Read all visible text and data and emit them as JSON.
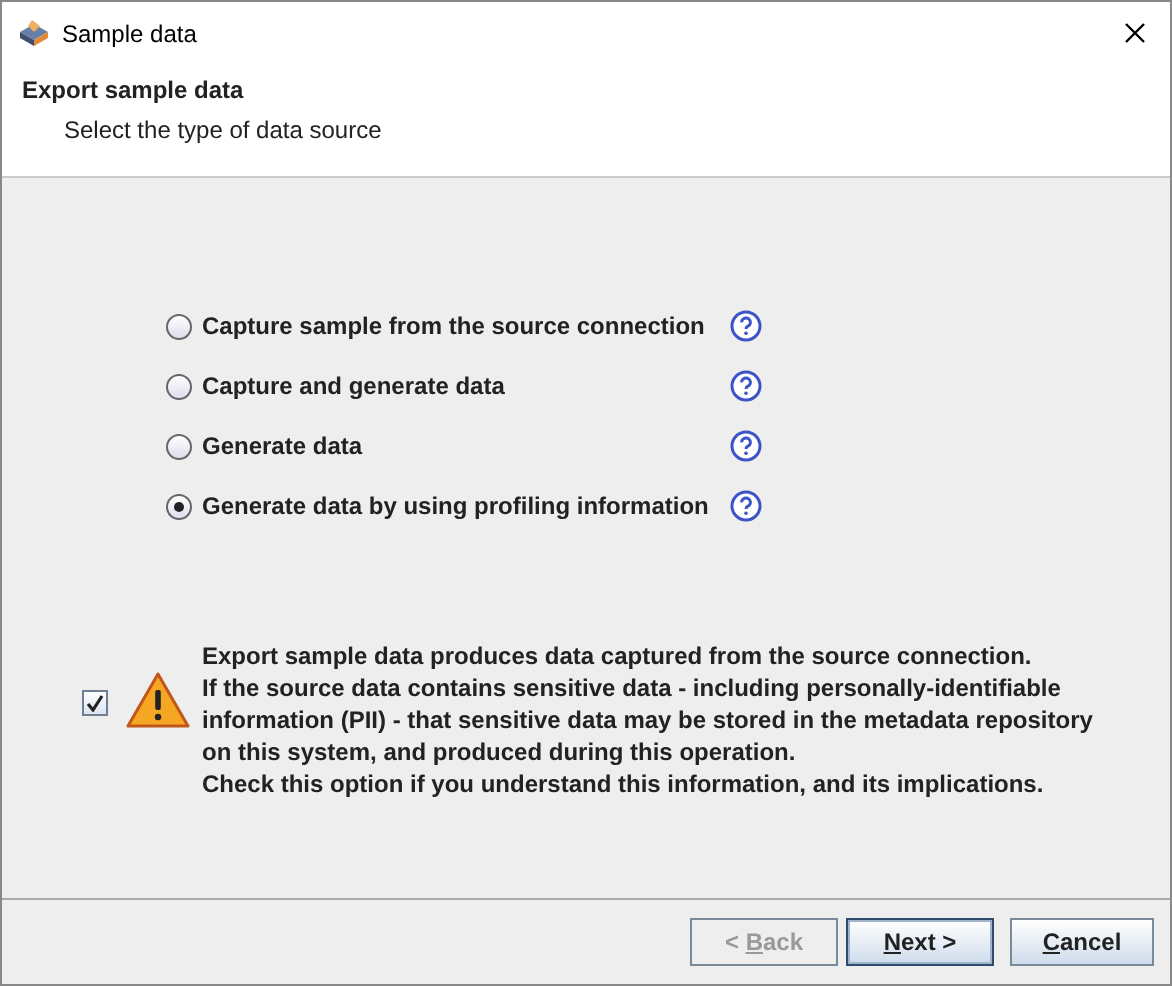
{
  "window": {
    "title": "Sample data"
  },
  "header": {
    "title": "Export sample data",
    "subtitle": "Select the type of data source"
  },
  "options": [
    {
      "label": "Capture sample from the source connection",
      "selected": false
    },
    {
      "label": "Capture and generate data",
      "selected": false
    },
    {
      "label": "Generate data",
      "selected": false
    },
    {
      "label": "Generate data by using profiling information",
      "selected": true
    }
  ],
  "acknowledgement": {
    "checked": true,
    "lines": [
      "Export sample data produces data captured from the source connection.",
      "If the source data contains sensitive data - including personally-identifiable",
      "information (PII) - that sensitive data may be stored in the metadata repository",
      "on this system, and produced during this operation.",
      "Check this option if you understand this information, and its implications."
    ]
  },
  "buttons": [
    {
      "prefix": "< ",
      "mnemonic": "B",
      "rest": "ack",
      "disabled": true,
      "default": false
    },
    {
      "mnemonic": "N",
      "rest": "ext >",
      "disabled": false,
      "default": true
    },
    {
      "mnemonic": "C",
      "rest": "ancel",
      "disabled": false,
      "default": false
    }
  ]
}
